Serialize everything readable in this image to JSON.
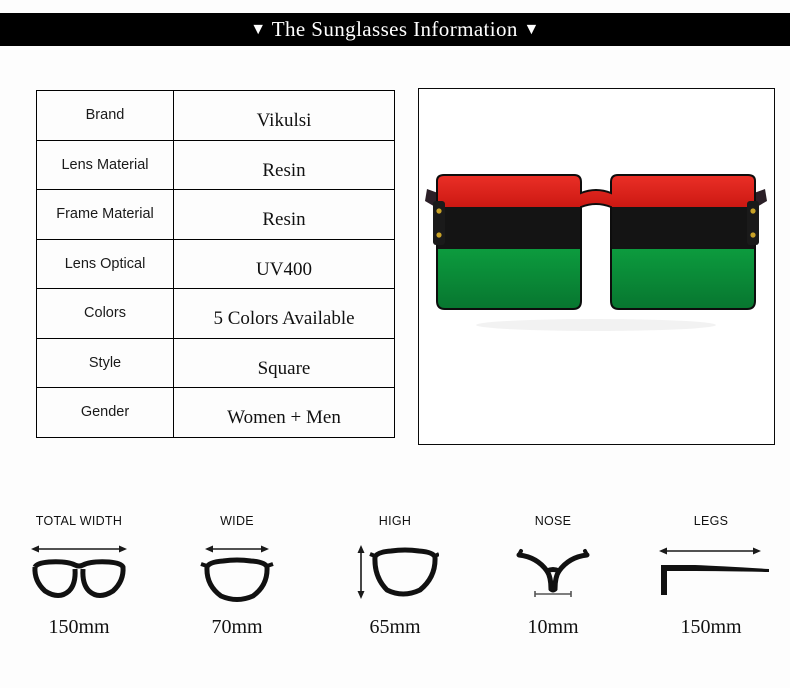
{
  "header": {
    "left_triangle": "▼",
    "title": "The Sunglasses Information",
    "right_triangle": "▼"
  },
  "spec_table": {
    "rows": [
      {
        "key": "Brand",
        "value": "Vikulsi"
      },
      {
        "key": "Lens Material",
        "value": "Resin"
      },
      {
        "key": "Frame Material",
        "value": "Resin"
      },
      {
        "key": "Lens Optical",
        "value": "UV400"
      },
      {
        "key": "Colors",
        "value": "5 Colors Available"
      },
      {
        "key": "Style",
        "value": "Square"
      },
      {
        "key": "Gender",
        "value": "Women + Men"
      }
    ]
  },
  "product_image": {
    "alt": "oversized square sunglasses",
    "frame_top_color": "#e8201a",
    "frame_bottom_color": "#0b8a38",
    "frame_bridge_color": "#141414",
    "lens_color_top": "#4a3040",
    "lens_color_bottom": "#c9bcc8",
    "rivet_color": "#c9a227",
    "background_color": "#ffffff"
  },
  "measurements": [
    {
      "label": "TOTAL WIDTH",
      "value": "150mm",
      "icon": "full-frame-icon"
    },
    {
      "label": "WIDE",
      "value": "70mm",
      "icon": "single-lens-width-icon"
    },
    {
      "label": "HIGH",
      "value": "65mm",
      "icon": "single-lens-height-icon"
    },
    {
      "label": "NOSE",
      "value": "10mm",
      "icon": "nose-bridge-icon"
    },
    {
      "label": "LEGS",
      "value": "150mm",
      "icon": "temple-arm-icon"
    }
  ]
}
